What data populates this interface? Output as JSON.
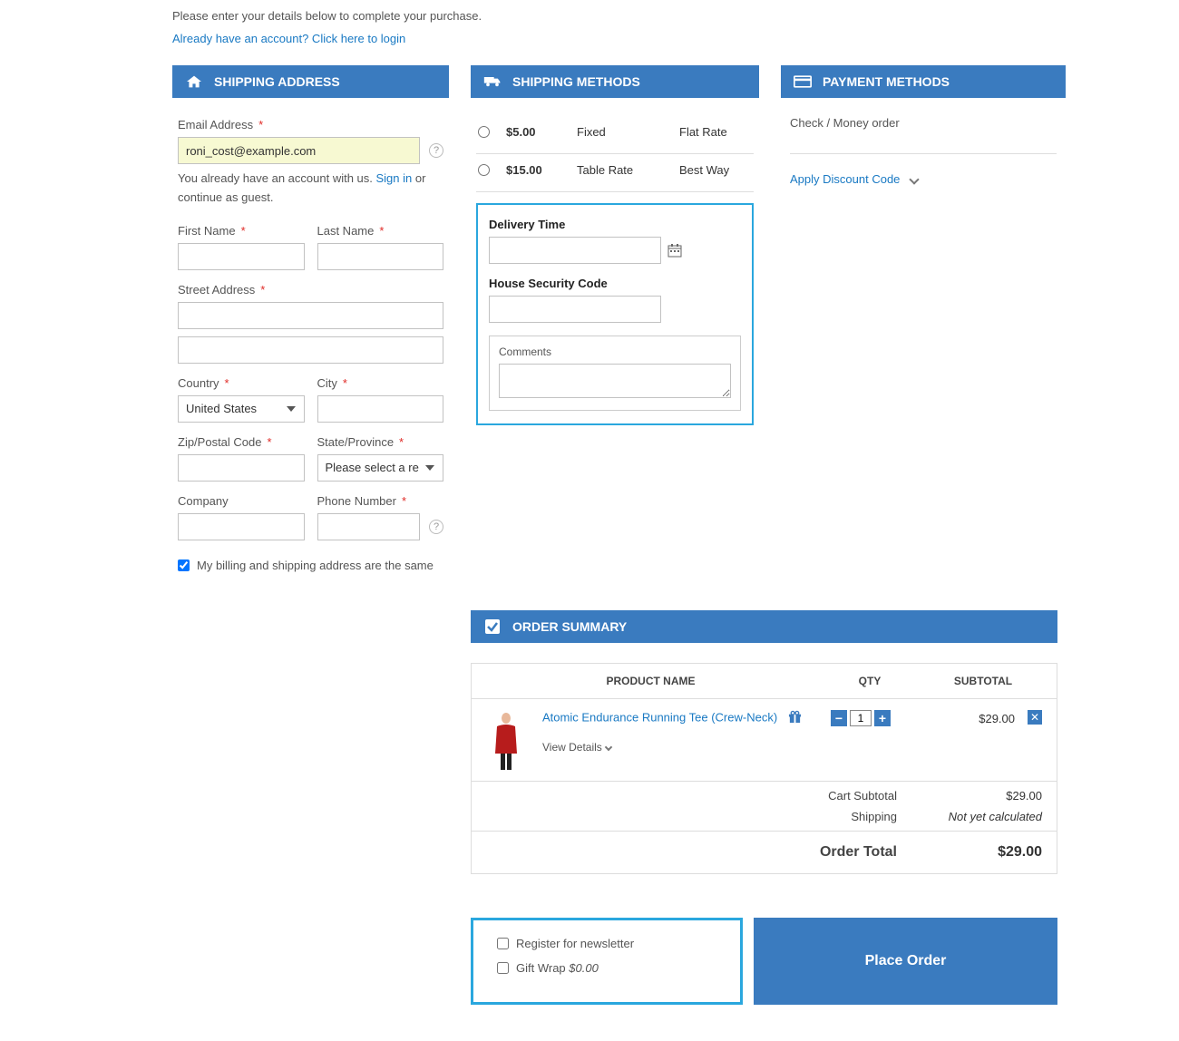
{
  "intro": "Please enter your details below to complete your purchase.",
  "login_link": "Already have an account? Click here to login",
  "shipping_address": {
    "title": "SHIPPING ADDRESS",
    "email_label": "Email Address",
    "email_value": "roni_cost@example.com",
    "account_msg_prefix": "You already have an account with us. ",
    "signin": "Sign in",
    "account_msg_suffix": " or continue as guest.",
    "first_name": "First Name",
    "last_name": "Last Name",
    "street": "Street Address",
    "country": "Country",
    "country_value": "United States",
    "city": "City",
    "zip": "Zip/Postal Code",
    "state": "State/Province",
    "state_placeholder": "Please select a region",
    "company": "Company",
    "phone": "Phone Number",
    "same_billing": "My billing and shipping address are the same"
  },
  "shipping_methods": {
    "title": "SHIPPING METHODS",
    "rows": [
      {
        "price": "$5.00",
        "method": "Fixed",
        "carrier": "Flat Rate"
      },
      {
        "price": "$15.00",
        "method": "Table Rate",
        "carrier": "Best Way"
      }
    ],
    "delivery_time": "Delivery Time",
    "house_security": "House Security Code",
    "comments": "Comments"
  },
  "payment": {
    "title": "PAYMENT METHODS",
    "method": "Check / Money order",
    "discount": "Apply Discount Code"
  },
  "summary": {
    "title": "ORDER SUMMARY",
    "headers": {
      "name": "PRODUCT NAME",
      "qty": "QTY",
      "subtotal": "SUBTOTAL"
    },
    "item": {
      "name": "Atomic Endurance Running Tee (Crew-Neck)",
      "view_details": "View Details",
      "qty": "1",
      "subtotal": "$29.00"
    },
    "cart_subtotal_label": "Cart Subtotal",
    "cart_subtotal": "$29.00",
    "shipping_label": "Shipping",
    "shipping_value": "Not yet calculated",
    "order_total_label": "Order Total",
    "order_total": "$29.00"
  },
  "extras": {
    "newsletter": "Register for newsletter",
    "giftwrap": "Gift Wrap ",
    "giftwrap_price": "$0.00"
  },
  "place_order": "Place Order"
}
